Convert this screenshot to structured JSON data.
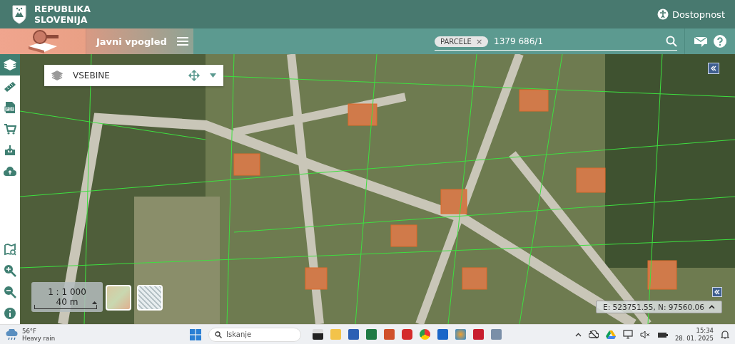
{
  "header": {
    "title_line1": "REPUBLIKA",
    "title_line2": "SLOVENIJA",
    "accessibility_link": "Dostopnost"
  },
  "toolbar": {
    "app_title": "Javni vpogled",
    "search": {
      "chip": "PARCELE",
      "chip_close": "×",
      "value": "1379 686/1"
    }
  },
  "sidebar": {
    "tools": [
      {
        "kind": "layers",
        "selected": true
      },
      {
        "kind": "ruler",
        "selected": false
      },
      {
        "kind": "pdf",
        "selected": false
      },
      {
        "kind": "cart",
        "selected": false
      },
      {
        "kind": "download",
        "selected": false
      },
      {
        "kind": "upload",
        "selected": false
      }
    ],
    "bottom_tools": [
      {
        "kind": "map-search",
        "selected": false
      },
      {
        "kind": "zoom-in",
        "selected": false
      },
      {
        "kind": "zoom-out",
        "selected": false
      },
      {
        "kind": "info",
        "selected": false
      }
    ]
  },
  "map": {
    "layers_panel": {
      "title": "VSEBINE"
    },
    "scale": {
      "ratio": "1 : 1 000",
      "distance": "40 m"
    },
    "coordinates": "E: 523751.55, N: 97560.06"
  },
  "taskbar": {
    "weather": {
      "temperature": "56°F",
      "condition": "Heavy rain"
    },
    "search_placeholder": "Iskanje",
    "time": "15:34",
    "date": "28. 01. 2025"
  }
}
